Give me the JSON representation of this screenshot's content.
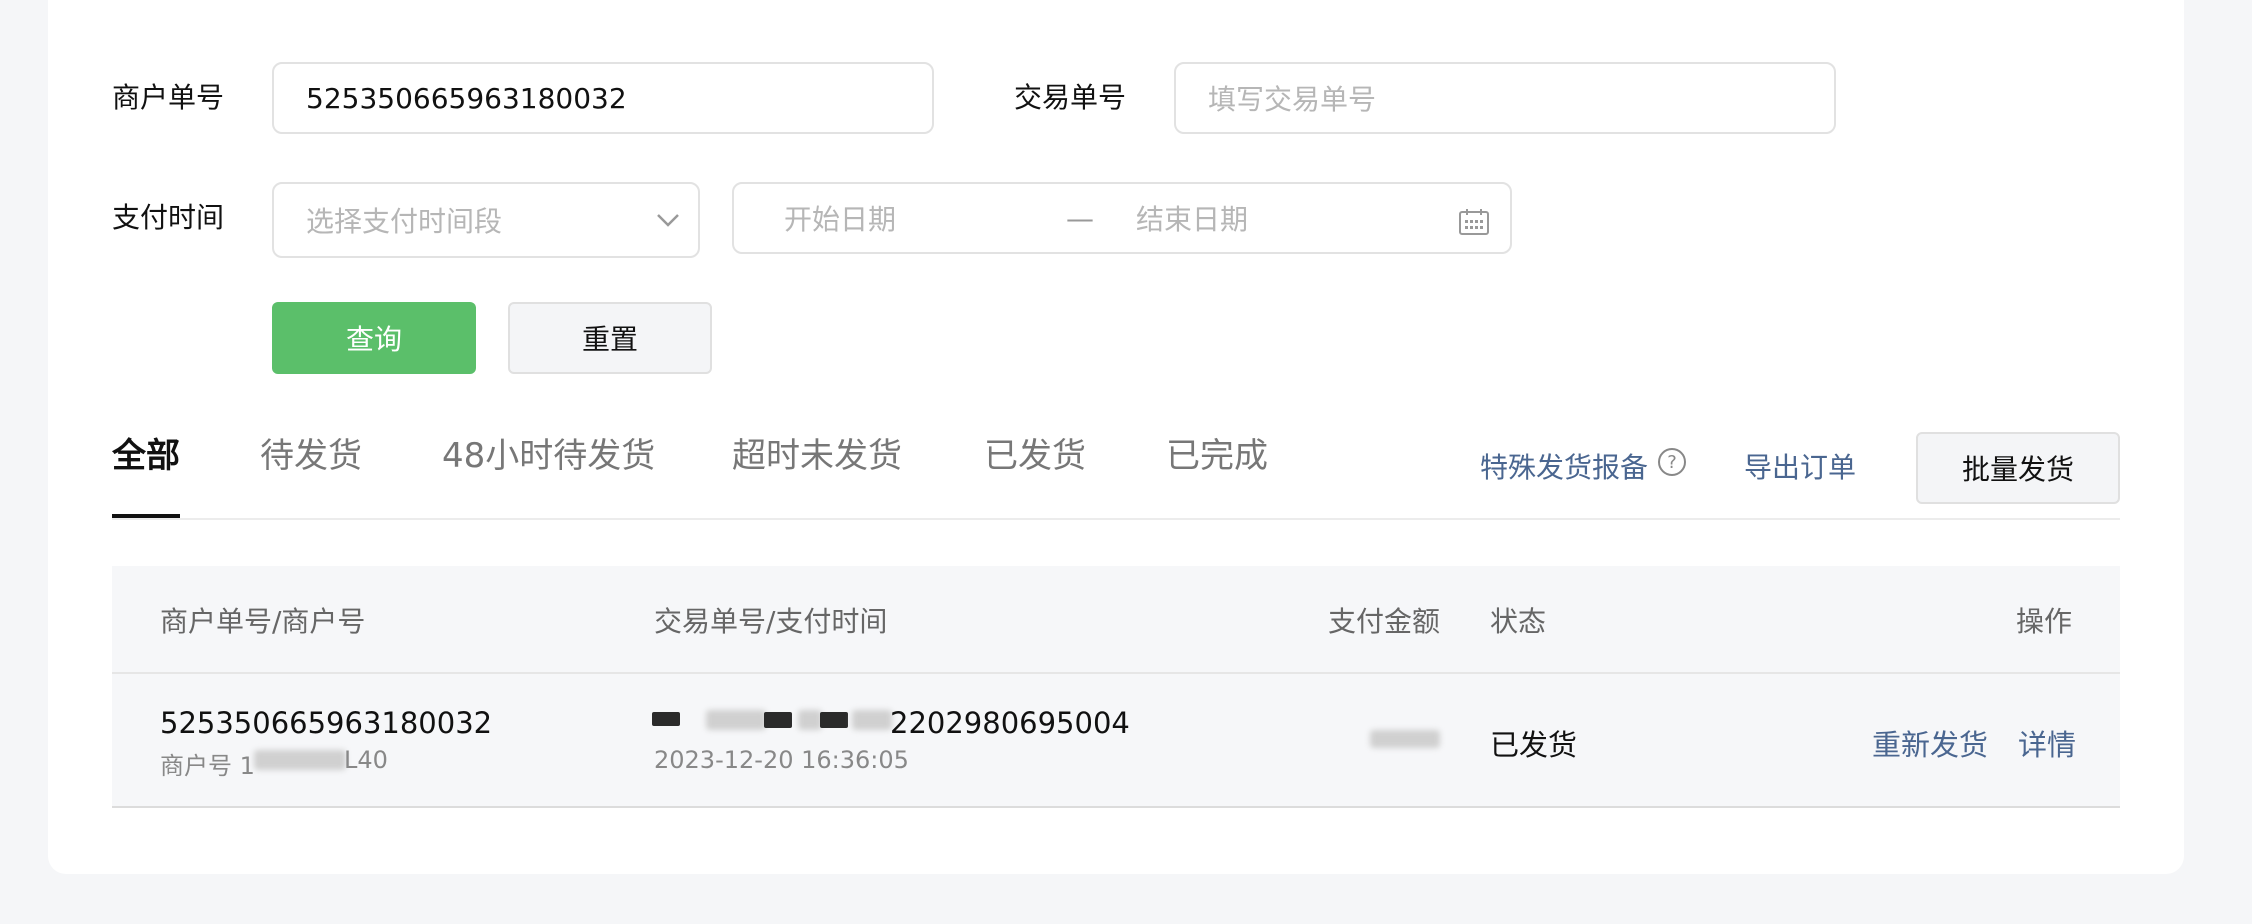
{
  "filters": {
    "merchant_order_label": "商户单号",
    "merchant_order_value": "525350665963180032",
    "trade_order_label": "交易单号",
    "trade_order_placeholder": "填写交易单号",
    "pay_time_label": "支付时间",
    "pay_time_select_placeholder": "选择支付时间段",
    "start_date_placeholder": "开始日期",
    "date_separator": "—",
    "end_date_placeholder": "结束日期",
    "query_button": "查询",
    "reset_button": "重置"
  },
  "tabs": [
    {
      "label": "全部",
      "active": true
    },
    {
      "label": "待发货"
    },
    {
      "label": "48小时待发货"
    },
    {
      "label": "超时未发货"
    },
    {
      "label": "已发货"
    },
    {
      "label": "已完成"
    }
  ],
  "actions": {
    "special_report": "特殊发货报备",
    "help_glyph": "?",
    "export": "导出订单",
    "batch_ship": "批量发货"
  },
  "table": {
    "headers": {
      "merchant": "商户单号/商户号",
      "trade": "交易单号/支付时间",
      "amount": "支付金额",
      "status": "状态",
      "ops": "操作"
    },
    "rows": [
      {
        "merchant_order": "525350665963180032",
        "merchant_no_prefix": "商户号 1",
        "merchant_no_suffix": "L40",
        "trade_no_visible": "2202980695004",
        "pay_time": "2023-12-20 16:36:05",
        "status": "已发货",
        "reship": "重新发货",
        "detail": "详情"
      }
    ]
  },
  "colors": {
    "primary_green": "#5bbf6a",
    "link_blue": "#4a6690",
    "page_bg": "#f5f6f8"
  }
}
